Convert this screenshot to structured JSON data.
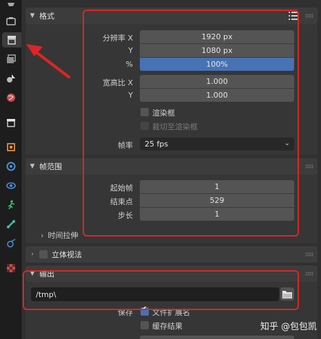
{
  "tabs": [
    {
      "icon": "tool-icon"
    },
    {
      "icon": "render-icon"
    },
    {
      "icon": "output-icon",
      "active": true
    },
    {
      "icon": "view-layer-icon"
    },
    {
      "icon": "scene-icon"
    },
    {
      "icon": "world-icon"
    },
    {
      "icon": "collection-icon"
    },
    {
      "icon": "object-icon"
    },
    {
      "icon": "modifier-icon"
    },
    {
      "icon": "particles-icon"
    },
    {
      "icon": "physics-icon"
    },
    {
      "icon": "constraints-icon"
    },
    {
      "icon": "data-icon"
    },
    {
      "icon": "texture-icon"
    }
  ],
  "format": {
    "title": "格式",
    "res_x_label": "分辨率 X",
    "res_x": "1920 px",
    "res_y_label": "Y",
    "res_y": "1080 px",
    "res_pct_label": "%",
    "res_pct": "100%",
    "aspect_x_label": "宽高比 X",
    "aspect_x": "1.000",
    "aspect_y_label": "Y",
    "aspect_y": "1.000",
    "render_region": "渲染框",
    "crop_region": "裁切至渲染框",
    "fps_label": "帧率",
    "fps": "25 fps"
  },
  "frame_range": {
    "title": "帧范围",
    "start_label": "起始帧",
    "start": "1",
    "end_label": "结束点",
    "end": "529",
    "step_label": "步长",
    "step": "1",
    "time_stretch": "时间拉伸"
  },
  "stereoscopy": {
    "title": "立体视法"
  },
  "output": {
    "title": "输出",
    "path": "/tmp\\",
    "save_label": "保存",
    "file_ext": "文件扩展名",
    "cache_result": "缓存结果"
  },
  "watermark": "知乎 @包包凯"
}
